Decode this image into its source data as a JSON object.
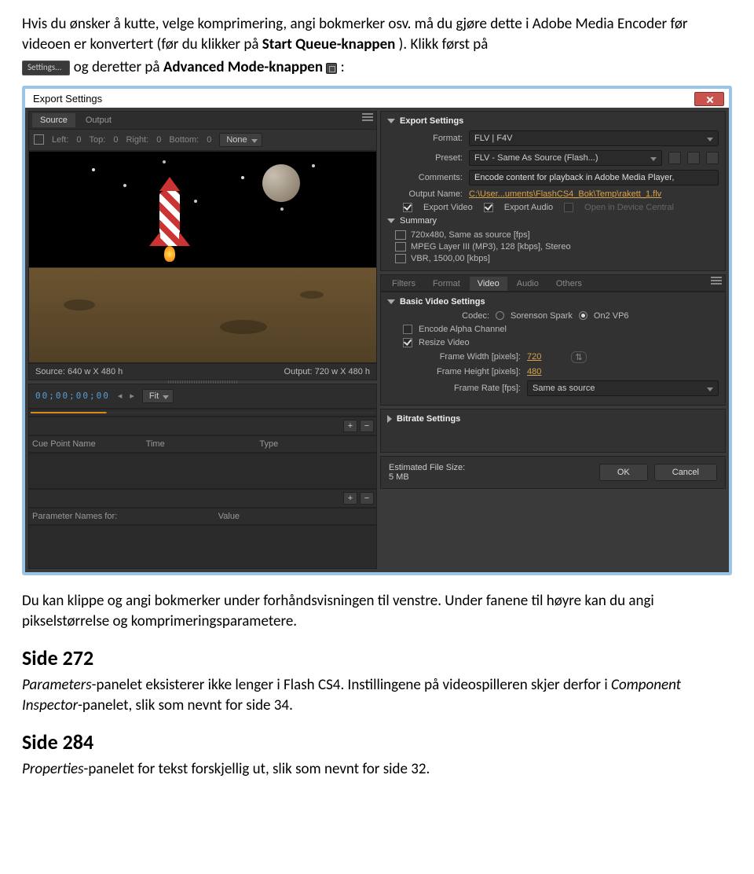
{
  "doc": {
    "p1a": "Hvis du ønsker å kutte, velge komprimering, angi bokmerker osv. må du gjøre dette i Adobe Media Encoder før videoen er konvertert (før du klikker på ",
    "p1_bold": "Start Queue-knappen",
    "p1b": "). Klikk først på ",
    "settings_btn": "Settings...",
    "p1c": " og deretter på ",
    "adv_bold": "Advanced Mode-knappen ",
    "p1d": " :",
    "p2": "Du kan klippe og angi bokmerker under forhåndsvisningen til venstre. Under fanene til høyre kan du angi pikselstørrelse og komprimeringsparametere.",
    "h272": "Side 272",
    "p3a": "Parameters",
    "p3b": "-panelet eksisterer ikke lenger i Flash CS4. Instillingene på videospilleren skjer derfor i ",
    "p3c": "Component Inspector",
    "p3d": "-panelet, slik som nevnt for side 34.",
    "h284": "Side 284",
    "p4a": "Properties",
    "p4b": "-panelet for tekst forskjellig ut, slik som nevnt for side 32."
  },
  "dlg": {
    "title": "Export Settings",
    "left": {
      "tabs": {
        "source": "Source",
        "output": "Output"
      },
      "crop": {
        "left_l": "Left:",
        "left_v": "0",
        "top_l": "Top:",
        "top_v": "0",
        "right_l": "Right:",
        "right_v": "0",
        "bottom_l": "Bottom:",
        "bottom_v": "0",
        "none": "None"
      },
      "source_dim": "Source: 640 w X 480 h",
      "output_dim": "Output: 720 w X 480 h",
      "timecode": "00;00;00;00",
      "fit": "Fit",
      "cue_cols": {
        "name": "Cue Point Name",
        "time": "Time",
        "type": "Type"
      },
      "param_cols": {
        "name": "Parameter Names for:",
        "value": "Value"
      }
    },
    "right": {
      "export_settings": "Export Settings",
      "format_l": "Format:",
      "format_v": "FLV | F4V",
      "preset_l": "Preset:",
      "preset_v": "FLV - Same As Source (Flash...)",
      "comments_l": "Comments:",
      "comments_v": "Encode content for playback in Adobe Media Player,",
      "output_l": "Output Name:",
      "output_v": "C:\\User...uments\\FlashCS4_Bok\\Temp\\rakett_1.flv",
      "chk_video": "Export Video",
      "chk_audio": "Export Audio",
      "chk_device": "Open in Device Central",
      "summary_h": "Summary",
      "sum1": "720x480, Same as source [fps]",
      "sum2": "MPEG Layer III (MP3), 128 [kbps], Stereo",
      "sum3": "VBR, 1500,00 [kbps]",
      "tabs": {
        "filters": "Filters",
        "format": "Format",
        "video": "Video",
        "audio": "Audio",
        "others": "Others"
      },
      "bvs_h": "Basic Video Settings",
      "codec_l": "Codec:",
      "codec_sorenson": "Sorenson Spark",
      "codec_on2": "On2 VP6",
      "alpha": "Encode Alpha Channel",
      "resize": "Resize Video",
      "fw_l": "Frame Width [pixels]:",
      "fw_v": "720",
      "fh_l": "Frame Height [pixels]:",
      "fh_v": "480",
      "fr_l": "Frame Rate [fps]:",
      "fr_v": "Same as source",
      "bitrate_h": "Bitrate Settings",
      "est_l": "Estimated File Size:",
      "est_v": "5 MB",
      "ok": "OK",
      "cancel": "Cancel"
    }
  }
}
